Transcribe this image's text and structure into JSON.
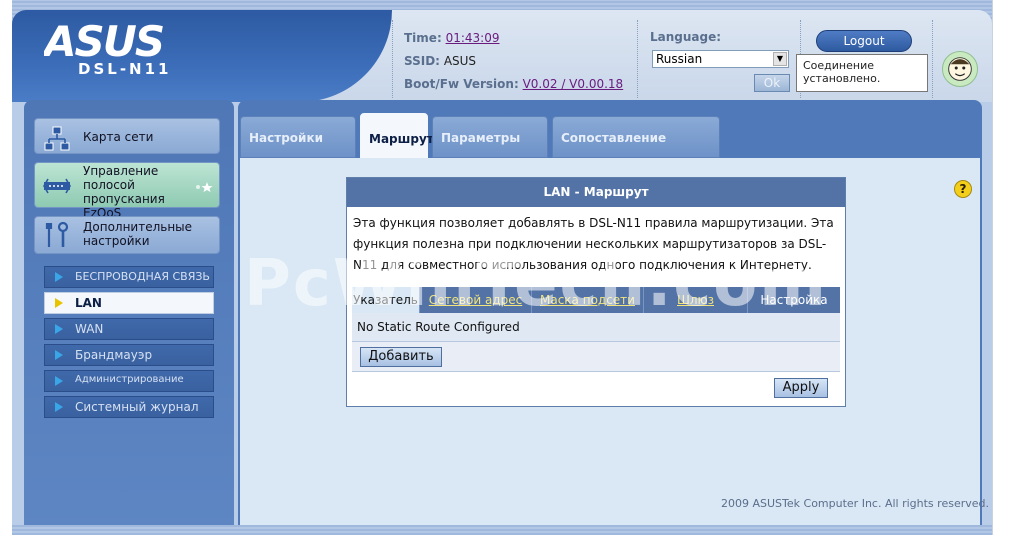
{
  "header": {
    "brand": "ASUS",
    "model": "DSL-N11",
    "time_label": "Time:",
    "time_value": "01:43:09",
    "ssid_label": "SSID:",
    "ssid_value": "ASUS",
    "boot_label": "Boot/Fw Version:",
    "boot_value": "V0.02 / V0.00.18",
    "language_label": "Language:",
    "language_selected": "Russian",
    "ok_label": "Ok",
    "logout_label": "Logout",
    "status_text": "Соединение установлено."
  },
  "sidebar": {
    "main_items": [
      {
        "label": "Карта сети"
      },
      {
        "label": "Управление полосой пропускания EzQoS"
      },
      {
        "label": "Дополнительные настройки"
      }
    ],
    "sub_items": [
      {
        "label": "БЕСПРОВОДНАЯ СВЯЗЬ"
      },
      {
        "label": "LAN"
      },
      {
        "label": "WAN"
      },
      {
        "label": "Брандмауэр"
      },
      {
        "label": "Администрирование"
      },
      {
        "label": "Системный журнал"
      }
    ]
  },
  "tabs": [
    {
      "label": "Настройки LAN"
    },
    {
      "label": "Маршрут"
    },
    {
      "label": "Параметры RIP"
    },
    {
      "label": "Сопоставление портов"
    }
  ],
  "panel": {
    "title": "LAN - Маршрут",
    "description": "Эта функция позволяет добавлять в DSL-N11 правила маршрутизации. Эта функция полезна при подключении нескольких маршрутизаторов за DSL-N11 для совместного использования одного подключения к Интернету.",
    "columns": [
      "Указатель",
      "Сетевой адрес",
      "Маска подсети",
      "Шлюз",
      "Настройка"
    ],
    "empty_text": "No Static Route Configured",
    "add_label": "Добавить",
    "apply_label": "Apply"
  },
  "help_label": "?",
  "watermark": "PcWinTech.com",
  "footer": "2009 ASUSTek Computer Inc. All rights reserved.",
  "colors": {
    "header_blue": "#2d5aa2",
    "panel_title": "#5373a7",
    "link_purple": "#6a1b7e",
    "column_link_yellow": "#f3e47b"
  }
}
